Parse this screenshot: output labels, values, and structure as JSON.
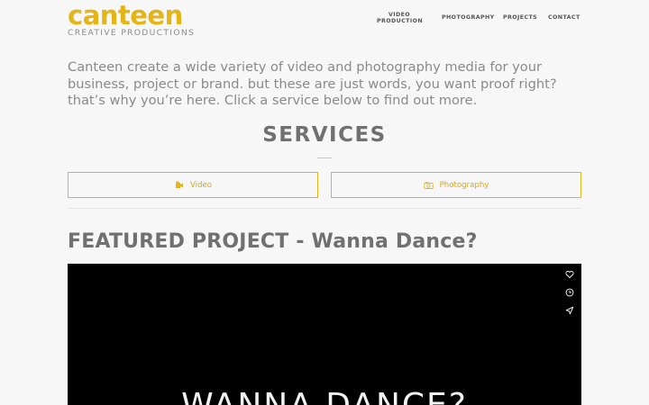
{
  "brand": {
    "name": "canteen",
    "tagline": "CREATIVE PRODUCTIONS",
    "accent": "#e5b515"
  },
  "nav": {
    "items": [
      {
        "label": "VIDEO PRODUCTION"
      },
      {
        "label": "PHOTOGRAPHY"
      },
      {
        "label": "PROJECTS"
      },
      {
        "label": "CONTACT"
      }
    ]
  },
  "intro": {
    "text": "Canteen create a wide variety of video and photography media for your business, project or brand. but these are just words, you want proof right? that’s why you’re here. Click a service below to find out more."
  },
  "services": {
    "title": "SERVICES",
    "buttons": [
      {
        "label": "Video",
        "icon": "video-camera-icon"
      },
      {
        "label": "Photography",
        "icon": "camera-icon"
      }
    ]
  },
  "featured": {
    "heading": "FEATURED PROJECT - Wanna Dance?",
    "video_title": "WANNA DANCE?",
    "actions": [
      {
        "icon": "heart-icon"
      },
      {
        "icon": "clock-icon"
      },
      {
        "icon": "share-icon"
      }
    ]
  }
}
